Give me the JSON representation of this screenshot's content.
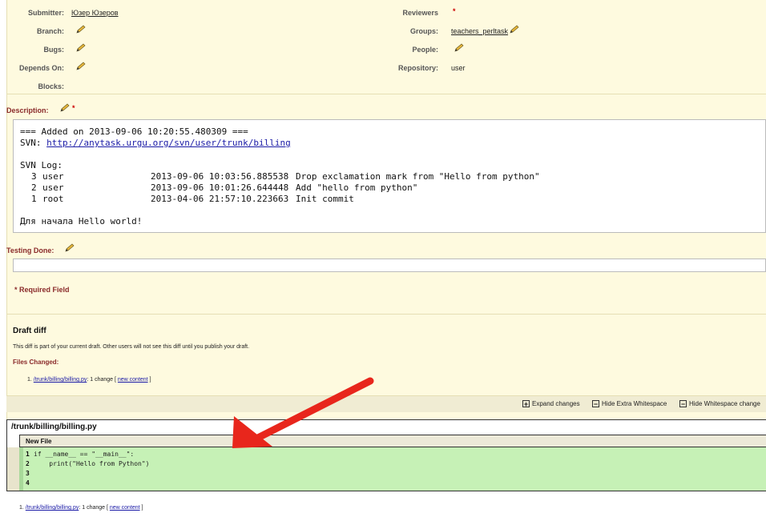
{
  "fields": {
    "submitter_label": "Submitter:",
    "submitter_value": "Юзер Юзеров",
    "reviewers_label": "Reviewers",
    "branch_label": "Branch:",
    "groups_label": "Groups:",
    "groups_value": "teachers_perltask",
    "bugs_label": "Bugs:",
    "people_label": "People:",
    "depends_label": "Depends On:",
    "repository_label": "Repository:",
    "repository_value": "user",
    "blocks_label": "Blocks:",
    "required_star": "*"
  },
  "description": {
    "label": "Description:",
    "line1": "=== Added on 2013-09-06 10:20:55.480309 ===",
    "svn_prefix": "SVN: ",
    "svn_link": "http://anytask.urgu.org/svn/user/trunk/billing",
    "log_title": "SVN Log:",
    "log": [
      {
        "num": "3",
        "user": "user",
        "date": "2013-09-06 10:03:56.885538",
        "msg": "Drop exclamation mark from \"Hello from python\""
      },
      {
        "num": "2",
        "user": "user",
        "date": "2013-09-06 10:01:26.644448",
        "msg": "Add \"hello from python\""
      },
      {
        "num": "1",
        "user": "root",
        "date": "2013-04-06 21:57:10.223663",
        "msg": "Init commit"
      }
    ],
    "footer": "Для начала Hello world!"
  },
  "testing": {
    "label": "Testing Done:"
  },
  "required_note": "* Required Field",
  "draft": {
    "title": "Draft diff",
    "note": "This diff is part of your current draft. Other users will not see this diff until you publish your draft.",
    "files_label": "Files Changed:",
    "file_num": "1.",
    "file_link": "/trunk/billing/billing.py",
    "file_change": ": 1 change [ ",
    "file_new": "new content",
    "file_close": " ]"
  },
  "toolbar": {
    "expand": "Expand changes",
    "hide_extra": "Hide Extra Whitespace",
    "hide_ws": "Hide Whitespace change"
  },
  "diff": {
    "filename": "/trunk/billing/billing.py",
    "status": "New File",
    "lines": [
      {
        "num": "1",
        "code": "if __name__ == \"__main__\":"
      },
      {
        "num": "2",
        "code": "    print(\"Hello from Python\")"
      },
      {
        "num": "3",
        "code": ""
      },
      {
        "num": "4",
        "code": ""
      }
    ]
  },
  "bottom": {
    "num": "1.",
    "link": "/trunk/billing/billing.py",
    "change": ": 1 change [ ",
    "new": "new content",
    "close": " ]"
  },
  "colors": {
    "panel_bg": "#fefadf",
    "diff_green": "#c6f1b6",
    "arrow": "#e8261c",
    "label_red": "#8a2a2a"
  }
}
